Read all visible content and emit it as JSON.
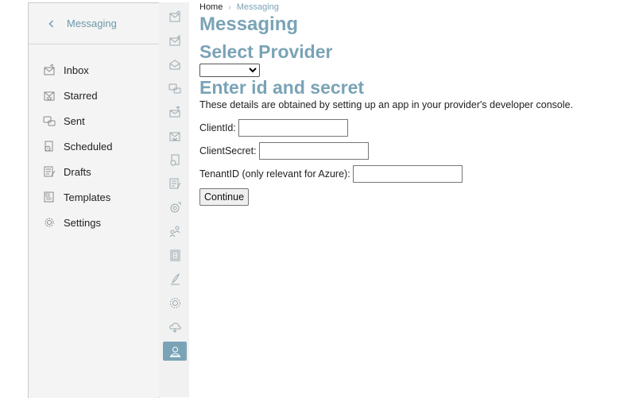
{
  "sidebar": {
    "title": "Messaging",
    "items": [
      {
        "label": "Inbox",
        "icon": "inbox-icon"
      },
      {
        "label": "Starred",
        "icon": "starred-icon"
      },
      {
        "label": "Sent",
        "icon": "sent-icon"
      },
      {
        "label": "Scheduled",
        "icon": "scheduled-icon"
      },
      {
        "label": "Drafts",
        "icon": "drafts-icon"
      },
      {
        "label": "Templates",
        "icon": "templates-icon"
      },
      {
        "label": "Settings",
        "icon": "settings-icon"
      }
    ]
  },
  "rail": {
    "icons": [
      "envelope-chart-icon",
      "envelope-send-icon",
      "envelope-open-icon",
      "chat-icon",
      "envelope-upload-icon",
      "envelope-x-icon",
      "document-tag-icon",
      "document-edit-icon",
      "target-refresh-icon",
      "users-icon",
      "book-icon",
      "quill-icon",
      "gear-icon",
      "cloud-icon",
      "user-icon"
    ],
    "active_index": 14,
    "accent": "#7aa3b6"
  },
  "breadcrumb": {
    "home": "Home",
    "separator": "›",
    "current": "Messaging"
  },
  "page": {
    "title": "Messaging",
    "provider_heading": "Select Provider",
    "provider_value": "",
    "secret_heading": "Enter id and secret",
    "hint": "These details are obtained by setting up an app in your provider's developer console.",
    "client_id_label": "ClientId:",
    "client_id_value": "",
    "client_secret_label": "ClientSecret:",
    "client_secret_value": "",
    "tenant_label": "TenantID (only relevant for Azure):",
    "tenant_value": "",
    "continue_label": "Continue"
  }
}
